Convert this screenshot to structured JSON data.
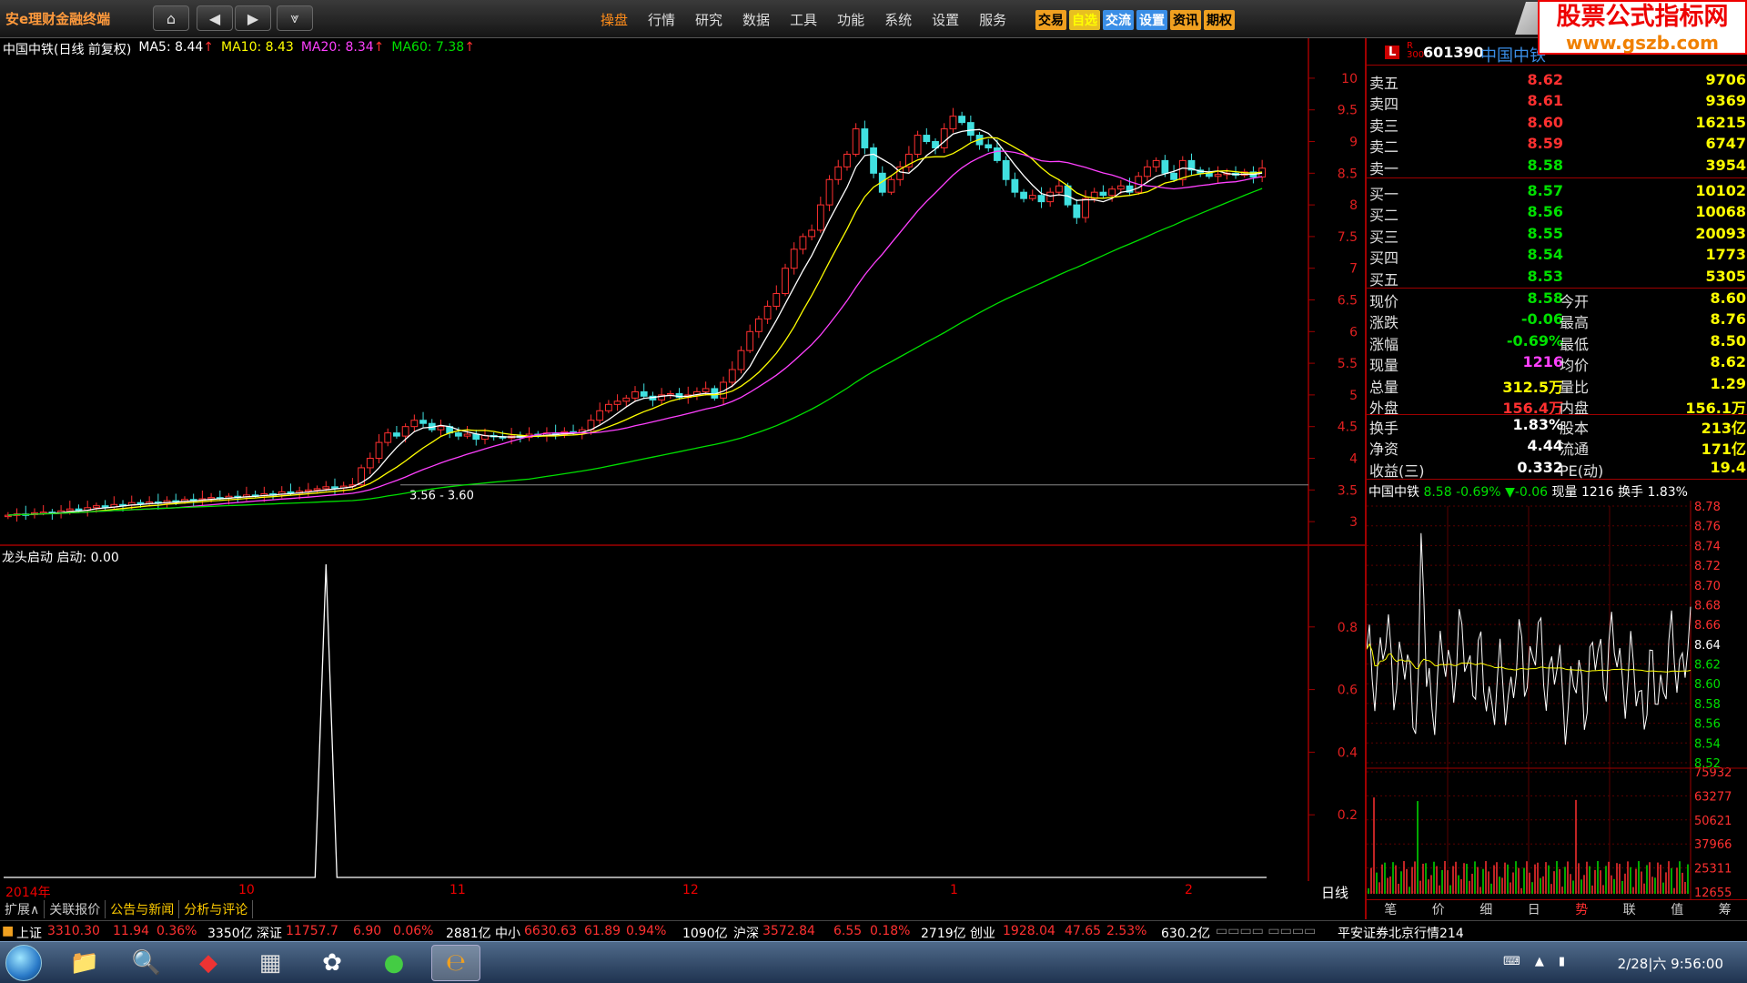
{
  "app": {
    "title": "安e理财金融终端"
  },
  "menu": [
    {
      "label": "操盘",
      "active": true
    },
    {
      "label": "行情",
      "active": false
    },
    {
      "label": "研究",
      "active": false
    },
    {
      "label": "数据",
      "active": false
    },
    {
      "label": "工具",
      "active": false
    },
    {
      "label": "功能",
      "active": false
    },
    {
      "label": "系统",
      "active": false
    },
    {
      "label": "设置",
      "active": false
    },
    {
      "label": "服务",
      "active": false
    }
  ],
  "quick_buttons": [
    {
      "label": "交易",
      "style": "orange"
    },
    {
      "label": "自选",
      "style": "yellow"
    },
    {
      "label": "交流",
      "style": "blue"
    },
    {
      "label": "设置",
      "style": "blue"
    },
    {
      "label": "资讯",
      "style": "orange"
    },
    {
      "label": "期权",
      "style": "orange"
    }
  ],
  "watermark": {
    "line1": "股票公式指标网",
    "line2": "www.gszb.com"
  },
  "chart_legend": {
    "stock": "中国中铁(日线 前复权)",
    "ma5": "MA5: 8.44",
    "ma10": "MA10: 8.43",
    "ma20": "MA20: 8.34",
    "ma60": "MA60: 7.38",
    "colors": {
      "ma5": "#ffffff",
      "ma10": "#ffff00",
      "ma20": "#ff40ff",
      "ma60": "#00e000"
    }
  },
  "indicator_legend": {
    "name": "龙头启动",
    "value": "启动: 0.00"
  },
  "range_annotation": "3.56 - 3.60",
  "date_axis": [
    "2014年",
    "10",
    "11",
    "12",
    "1",
    "2"
  ],
  "period": "日线",
  "bottom_tabs": [
    {
      "label": "扩展∧",
      "active": false
    },
    {
      "label": "关联报价",
      "active": false
    },
    {
      "label": "公告与新闻",
      "active": true
    },
    {
      "label": "分析与评论",
      "active": true
    }
  ],
  "ticker": {
    "sh": {
      "name": "上证",
      "index": "3310.30",
      "chg": "11.94",
      "pct": "0.36%",
      "amt": "3350亿"
    },
    "sz": {
      "name": "深证",
      "index": "11757.7",
      "chg": "6.90",
      "pct": "0.06%",
      "amt": "2881亿"
    },
    "zx": {
      "name": "中小",
      "index": "6630.63",
      "chg": "61.89",
      "pct": "0.94%",
      "amt": "1090亿"
    },
    "hs": {
      "name": "沪深",
      "index": "3572.84",
      "chg": "6.55",
      "pct": "0.18%",
      "amt": "2719亿"
    },
    "cy": {
      "name": "创业",
      "index": "1928.04",
      "chg": "47.65",
      "pct": "2.53%",
      "amt": "630.2亿"
    },
    "broker": "平安证券北京行情214"
  },
  "quote": {
    "badge": "L",
    "badge_r": "R",
    "badge_r_num": "300",
    "code": "601390",
    "name": "中国中铁",
    "asks": [
      {
        "label": "卖五",
        "price": "8.62",
        "vol": "9706"
      },
      {
        "label": "卖四",
        "price": "8.61",
        "vol": "9369"
      },
      {
        "label": "卖三",
        "price": "8.60",
        "vol": "16215"
      },
      {
        "label": "卖二",
        "price": "8.59",
        "vol": "6747"
      },
      {
        "label": "卖一",
        "price": "8.58",
        "vol": "3954"
      }
    ],
    "bids": [
      {
        "label": "买一",
        "price": "8.57",
        "vol": "10102"
      },
      {
        "label": "买二",
        "price": "8.56",
        "vol": "10068"
      },
      {
        "label": "买三",
        "price": "8.55",
        "vol": "20093"
      },
      {
        "label": "买四",
        "price": "8.54",
        "vol": "1773"
      },
      {
        "label": "买五",
        "price": "8.53",
        "vol": "5305"
      }
    ],
    "stats": [
      {
        "l1": "现价",
        "v1": "8.58",
        "c1": "green",
        "l2": "今开",
        "v2": "8.60",
        "c2": "green"
      },
      {
        "l1": "涨跌",
        "v1": "-0.06",
        "c1": "green",
        "l2": "最高",
        "v2": "8.76",
        "c2": "red"
      },
      {
        "l1": "涨幅",
        "v1": "-0.69%",
        "c1": "green",
        "l2": "最低",
        "v2": "8.50",
        "c2": "green"
      },
      {
        "l1": "现量",
        "v1": "1216",
        "c1": "magenta",
        "l2": "均价",
        "v2": "8.62",
        "c2": "red"
      },
      {
        "l1": "总量",
        "v1": "312.5万",
        "c1": "yellow",
        "l2": "量比",
        "v2": "1.29",
        "c2": "red"
      },
      {
        "l1": "外盘",
        "v1": "156.4万",
        "c1": "red",
        "l2": "内盘",
        "v2": "156.1万",
        "c2": "green"
      }
    ],
    "stats2": [
      {
        "l1": "换手",
        "v1": "1.83%",
        "l2": "股本",
        "v2": "213亿"
      },
      {
        "l1": "净资",
        "v1": "4.44",
        "l2": "流通",
        "v2": "171亿"
      },
      {
        "l1": "收益(三)",
        "v1": "0.332",
        "l2": "PE(动)",
        "v2": "19.4"
      }
    ]
  },
  "mini_chart": {
    "title_name": "中国中铁",
    "title_price": "8.58",
    "title_pct": "-0.69%",
    "title_chg": "▼-0.06",
    "title_vol": "现量 1216",
    "title_turn": "换手 1.83%",
    "price_ticks": [
      "8.78",
      "8.76",
      "8.74",
      "8.72",
      "8.70",
      "8.68",
      "8.66",
      "8.64",
      "8.62",
      "8.60",
      "8.58",
      "8.56",
      "8.54",
      "8.52"
    ],
    "vol_ticks": [
      "75932",
      "63277",
      "50621",
      "37966",
      "25311",
      "12655"
    ]
  },
  "mini_tabs": [
    {
      "label": "笔",
      "active": false
    },
    {
      "label": "价",
      "active": false
    },
    {
      "label": "细",
      "active": false
    },
    {
      "label": "日",
      "active": false
    },
    {
      "label": "势",
      "active": true
    },
    {
      "label": "联",
      "active": false
    },
    {
      "label": "值",
      "active": false
    },
    {
      "label": "筹",
      "active": false
    }
  ],
  "taskbar": {
    "clock": "2/28|六 9:56:00"
  },
  "chart_data": [
    {
      "type": "candlestick",
      "title": "中国中铁(日线 前复权)",
      "ylim": [
        2.8,
        10.2
      ],
      "y_ticks": [
        3.0,
        3.5,
        4.0,
        4.5,
        5.0,
        5.5,
        6.0,
        6.5,
        7.0,
        7.5,
        8.0,
        8.5,
        9.0,
        9.5,
        10.0
      ],
      "x_labels": [
        "2014年",
        "10",
        "11",
        "12",
        "1",
        "2"
      ],
      "close": [
        3.1,
        3.12,
        3.11,
        3.14,
        3.15,
        3.13,
        3.17,
        3.2,
        3.18,
        3.22,
        3.25,
        3.23,
        3.27,
        3.26,
        3.3,
        3.28,
        3.31,
        3.29,
        3.33,
        3.32,
        3.35,
        3.34,
        3.36,
        3.38,
        3.37,
        3.4,
        3.39,
        3.42,
        3.41,
        3.44,
        3.43,
        3.47,
        3.45,
        3.48,
        3.5,
        3.52,
        3.55,
        3.53,
        3.56,
        3.58,
        3.85,
        4.0,
        4.25,
        4.4,
        4.35,
        4.5,
        4.6,
        4.55,
        4.45,
        4.5,
        4.4,
        4.35,
        4.38,
        4.3,
        4.36,
        4.34,
        4.32,
        4.35,
        4.33,
        4.38,
        4.36,
        4.4,
        4.38,
        4.42,
        4.4,
        4.45,
        4.6,
        4.75,
        4.85,
        4.9,
        4.95,
        5.05,
        4.98,
        4.92,
        5.0,
        5.02,
        4.96,
        5.0,
        5.05,
        5.1,
        4.95,
        5.2,
        5.4,
        5.7,
        6.0,
        6.2,
        6.4,
        6.6,
        7.0,
        7.3,
        7.5,
        7.6,
        8.0,
        8.4,
        8.6,
        8.8,
        9.2,
        8.9,
        8.5,
        8.2,
        8.4,
        8.6,
        8.8,
        9.1,
        9.0,
        8.9,
        9.2,
        9.4,
        9.3,
        9.1,
        8.95,
        8.9,
        8.7,
        8.4,
        8.2,
        8.1,
        8.15,
        8.05,
        8.2,
        8.3,
        8.0,
        7.8,
        8.1,
        8.2,
        8.15,
        8.25,
        8.3,
        8.2,
        8.45,
        8.6,
        8.7,
        8.5,
        8.4,
        8.7,
        8.55,
        8.5,
        8.45,
        8.48,
        8.5,
        8.47,
        8.52,
        8.44,
        8.58
      ],
      "ma5_last": 8.44,
      "ma10_last": 8.43,
      "ma20_last": 8.34,
      "ma60_last": 7.38
    },
    {
      "type": "line",
      "title": "龙头启动",
      "ylim": [
        0,
        1.0
      ],
      "y_ticks": [
        0.2,
        0.4,
        0.6,
        0.8
      ],
      "spike_index": 36,
      "spike_value": 1.0
    }
  ]
}
